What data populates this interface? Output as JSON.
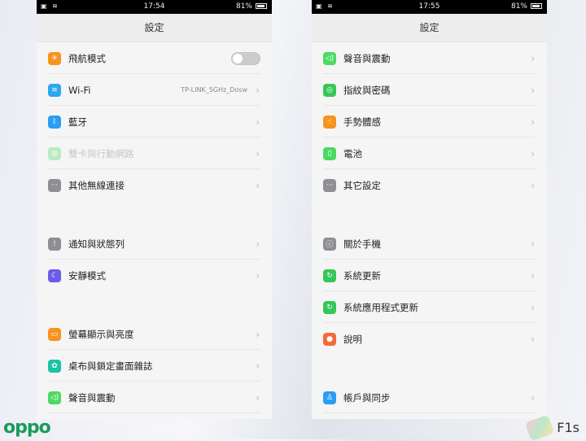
{
  "brand": "oppo",
  "model": "F1s",
  "phones": [
    {
      "time": "17:54",
      "battery": "81%",
      "title": "設定",
      "rows": [
        {
          "icon": "airplane-icon",
          "glyph": "✈",
          "color": "#f7931e",
          "label": "飛航模式",
          "toggle": false
        },
        {
          "icon": "wifi-icon",
          "glyph": "≋",
          "color": "#2aa8f2",
          "label": "Wi-Fi",
          "value": "TP-LINK_5GHz_Dosw"
        },
        {
          "icon": "bluetooth-icon",
          "glyph": "ᛒ",
          "color": "#2a9df4",
          "label": "藍牙"
        },
        {
          "icon": "sim-network-icon",
          "glyph": "◍",
          "color": "#4cd964",
          "label": "雙卡與行動網路",
          "disabled": true
        },
        {
          "icon": "more-connections-icon",
          "glyph": "···",
          "color": "#8e8e93",
          "label": "其他無線連接",
          "last": true
        },
        {
          "gap": true
        },
        {
          "icon": "notification-icon",
          "glyph": "!",
          "color": "#8e8e93",
          "label": "通知與狀態列"
        },
        {
          "icon": "moon-icon",
          "glyph": "☾",
          "color": "#6b5ce7",
          "label": "安靜模式",
          "last": true
        },
        {
          "gap": true
        },
        {
          "icon": "display-icon",
          "glyph": "▭",
          "color": "#f7931e",
          "label": "螢幕顯示與亮度"
        },
        {
          "icon": "wallpaper-icon",
          "glyph": "✿",
          "color": "#1bc3a4",
          "label": "桌布與鎖定畫面雜誌"
        },
        {
          "icon": "sound-icon",
          "glyph": "◁)",
          "color": "#4cd964",
          "label": "聲音與震動"
        }
      ]
    },
    {
      "time": "17:55",
      "battery": "81%",
      "title": "設定",
      "rows": [
        {
          "icon": "sound-icon",
          "glyph": "◁)",
          "color": "#4cd964",
          "label": "聲音與震動"
        },
        {
          "icon": "fingerprint-icon",
          "glyph": "◎",
          "color": "#35c759",
          "label": "指紋與密碼"
        },
        {
          "icon": "gesture-icon",
          "glyph": "☝",
          "color": "#f7931e",
          "label": "手勢體感"
        },
        {
          "icon": "battery-icon",
          "glyph": "▯",
          "color": "#4cd964",
          "label": "電池"
        },
        {
          "icon": "other-settings-icon",
          "glyph": "···",
          "color": "#8e8e93",
          "label": "其它設定",
          "last": true
        },
        {
          "gap": true
        },
        {
          "icon": "info-icon",
          "glyph": "ⓘ",
          "color": "#8e8e93",
          "label": "關於手機"
        },
        {
          "icon": "system-update-icon",
          "glyph": "↻",
          "color": "#35c759",
          "label": "系統更新"
        },
        {
          "icon": "app-update-icon",
          "glyph": "↻",
          "color": "#35c759",
          "label": "系統應用程式更新"
        },
        {
          "icon": "help-icon",
          "glyph": "●",
          "color": "#f56a3a",
          "label": "說明",
          "last": true
        },
        {
          "gap": true
        },
        {
          "icon": "account-icon",
          "glyph": "♙",
          "color": "#2a9df4",
          "label": "帳戶與同步"
        }
      ]
    }
  ]
}
